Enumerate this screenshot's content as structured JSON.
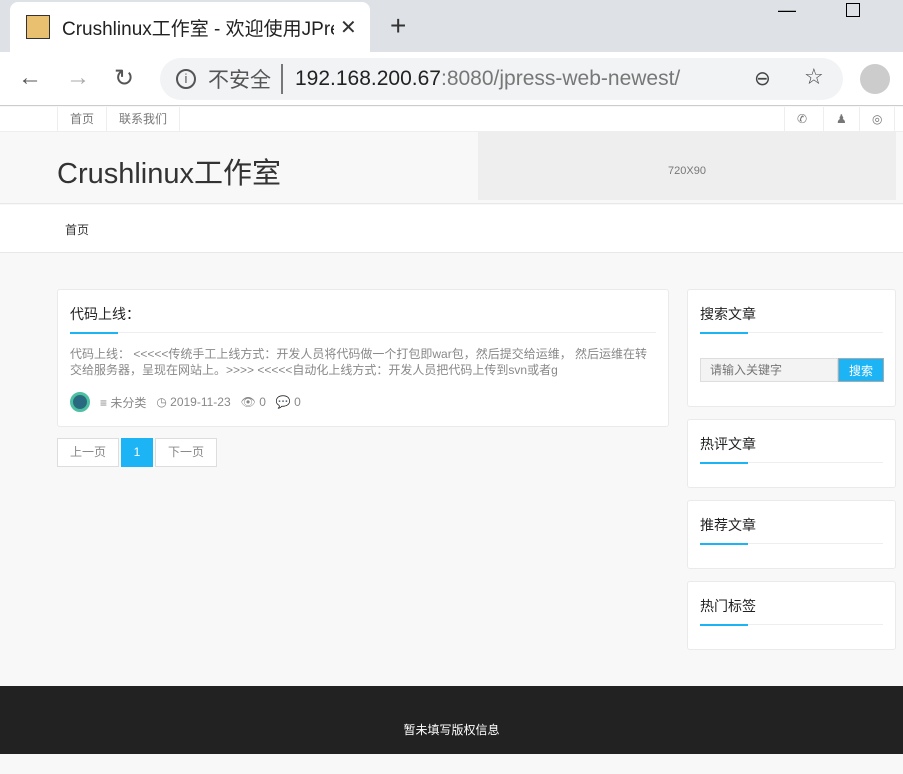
{
  "browser": {
    "tab_title": "Crushlinux工作室 - 欢迎使用JPress",
    "close": "✕",
    "new_tab": "+",
    "insecure": "不安全",
    "url_host": "192.168.200.67",
    "url_rest": ":8080/jpress-web-newest/",
    "back": "←",
    "forward": "→",
    "reload": "↻",
    "zoom": "⊖",
    "star": "☆",
    "info": "i",
    "min": "—"
  },
  "topnav": {
    "items": [
      "首页",
      "联系我们"
    ],
    "social": [
      "wechat-icon",
      "qq-icon",
      "weibo-icon"
    ]
  },
  "site": {
    "logo": "Crushlinux工作室",
    "ad": "720X90",
    "menu": [
      "首页"
    ]
  },
  "post": {
    "title": "代码上线：",
    "excerpt": "代码上线： <<<<<传统手工上线方式：开发人员将代码做一个打包即war包，然后提交给运维， 然后运维在转交给服务器，呈现在网站上。>>>> <<<<<自动化上线方式：开发人员把代码上传到svn或者g",
    "category": "≡ 未分类",
    "date": "◷ 2019-11-23",
    "views": "👁 0",
    "comments": "💬 0"
  },
  "pagination": {
    "prev": "上一页",
    "current": "1",
    "next": "下一页"
  },
  "sidebar": {
    "search_title": "搜索文章",
    "search_placeholder": "请输入关键字",
    "search_button": "搜索",
    "widgets": [
      "热评文章",
      "推荐文章",
      "热门标签"
    ]
  },
  "footer": {
    "text": "暂未填写版权信息"
  },
  "colors": {
    "accent": "#1db4f5"
  }
}
